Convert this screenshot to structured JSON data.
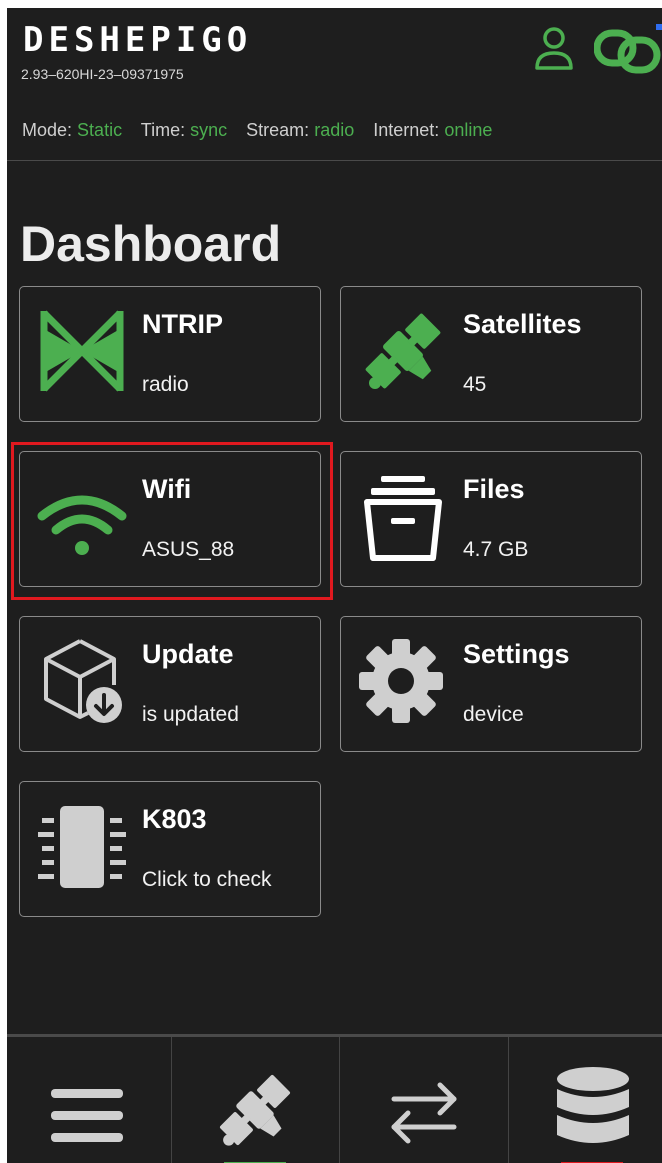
{
  "app": {
    "brand": "DESHEPIGO",
    "serial": "2.93–620HI-23–09371975"
  },
  "status": {
    "mode_label": "Mode:",
    "mode_value": "Static",
    "time_label": "Time:",
    "time_value": "sync",
    "stream_label": "Stream:",
    "stream_value": "radio",
    "internet_label": "Internet:",
    "internet_value": "online"
  },
  "page": {
    "title": "Dashboard"
  },
  "cards": {
    "ntrip": {
      "title": "NTRIP",
      "subtitle": "radio",
      "icon": "ntrip-icon"
    },
    "satellites": {
      "title": "Satellites",
      "subtitle": "45",
      "icon": "satellite-icon"
    },
    "wifi": {
      "title": "Wifi",
      "subtitle": "ASUS_88",
      "icon": "wifi-icon"
    },
    "files": {
      "title": "Files",
      "subtitle": "4.7 GB",
      "icon": "archive-box-icon"
    },
    "update": {
      "title": "Update",
      "subtitle": "is updated",
      "icon": "package-download-icon"
    },
    "settings": {
      "title": "Settings",
      "subtitle": "device",
      "icon": "gear-icon"
    },
    "k803": {
      "title": "K803",
      "subtitle": "Click to check",
      "icon": "chip-icon"
    }
  },
  "nav": {
    "items": [
      {
        "icon": "menu-icon"
      },
      {
        "icon": "satellite-icon",
        "indicator": "#4caf50"
      },
      {
        "icon": "transfer-arrows-icon"
      },
      {
        "icon": "database-icon",
        "indicator": "#e0191f"
      }
    ]
  },
  "colors": {
    "accent": "#4caf50",
    "highlight": "#e0191f",
    "background": "#1e1e1e",
    "icon_gray": "#cfcfcf"
  }
}
